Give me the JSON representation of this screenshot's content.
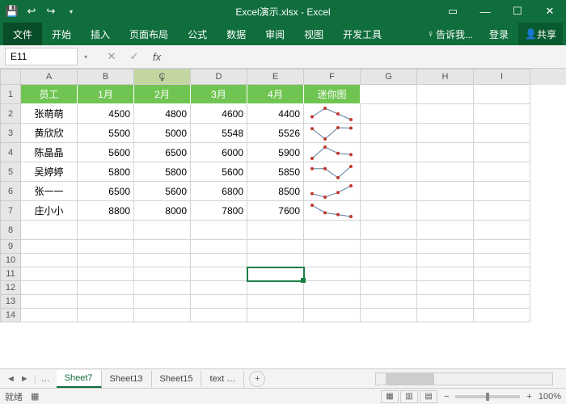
{
  "title": "Excel演示.xlsx - Excel",
  "ribbon": {
    "file": "文件",
    "tabs": [
      "开始",
      "插入",
      "页面布局",
      "公式",
      "数据",
      "审阅",
      "视图",
      "开发工具"
    ],
    "tellme": "告诉我...",
    "login": "登录",
    "share": "共享"
  },
  "namebox": "E11",
  "fx_label": "fx",
  "columns": [
    "A",
    "B",
    "C",
    "D",
    "E",
    "F",
    "G",
    "H",
    "I"
  ],
  "headers": [
    "员工",
    "1月",
    "2月",
    "3月",
    "4月",
    "迷你图"
  ],
  "data_rows": [
    {
      "name": "张萌萌",
      "vals": [
        4500,
        4800,
        4600,
        4400
      ]
    },
    {
      "name": "黄欣欣",
      "vals": [
        5500,
        5000,
        5548,
        5526
      ]
    },
    {
      "name": "陈晶晶",
      "vals": [
        5600,
        6500,
        6000,
        5900
      ]
    },
    {
      "name": "吴婷婷",
      "vals": [
        5800,
        5800,
        5600,
        5850
      ]
    },
    {
      "name": "张一一",
      "vals": [
        6500,
        5600,
        6800,
        8500
      ]
    },
    {
      "name": "庄小小",
      "vals": [
        8800,
        8000,
        7800,
        7600
      ]
    }
  ],
  "sheets": [
    "Sheet7",
    "Sheet13",
    "Sheet15",
    "text"
  ],
  "active_sheet": "Sheet7",
  "status": "就绪",
  "zoom": "100%",
  "chart_data": {
    "type": "line",
    "note": "per-row sparklines of monthly values",
    "categories": [
      "1月",
      "2月",
      "3月",
      "4月"
    ],
    "series": [
      {
        "name": "张萌萌",
        "values": [
          4500,
          4800,
          4600,
          4400
        ]
      },
      {
        "name": "黄欣欣",
        "values": [
          5500,
          5000,
          5548,
          5526
        ]
      },
      {
        "name": "陈晶晶",
        "values": [
          5600,
          6500,
          6000,
          5900
        ]
      },
      {
        "name": "吴婷婷",
        "values": [
          5800,
          5800,
          5600,
          5850
        ]
      },
      {
        "name": "张一一",
        "values": [
          6500,
          5600,
          6800,
          8500
        ]
      },
      {
        "name": "庄小小",
        "values": [
          8800,
          8000,
          7800,
          7600
        ]
      }
    ]
  }
}
